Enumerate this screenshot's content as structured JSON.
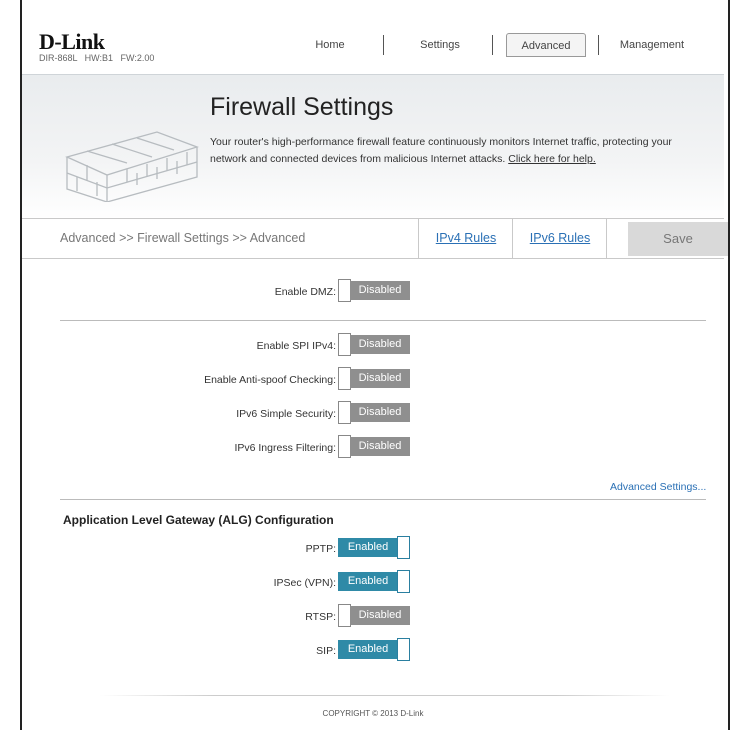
{
  "header": {
    "logo": "D-Link",
    "model_info": "DIR-868L   HW:B1   FW:2.00",
    "nav": [
      {
        "label": "Home"
      },
      {
        "label": "Settings"
      },
      {
        "label": "Advanced",
        "active": true
      },
      {
        "label": "Management"
      }
    ]
  },
  "hero": {
    "title": "Firewall Settings",
    "description": "Your router's high-performance firewall feature continuously monitors Internet traffic, protecting your network and connected devices from malicious Internet attacks. ",
    "help_link": "Click here for help."
  },
  "breadcrumb": {
    "path": "Advanced >> Firewall Settings >> Advanced",
    "ipv4_rules": "IPv4 Rules",
    "ipv6_rules": "IPv6 Rules",
    "save": "Save"
  },
  "dmz": {
    "label": "Enable DMZ:",
    "state": "Disabled"
  },
  "security": {
    "spi": {
      "label": "Enable SPI IPv4:",
      "state": "Disabled"
    },
    "antispoof": {
      "label": "Enable Anti-spoof Checking:",
      "state": "Disabled"
    },
    "ipv6_simple": {
      "label": "IPv6 Simple Security:",
      "state": "Disabled"
    },
    "ipv6_ingress": {
      "label": "IPv6 Ingress Filtering:",
      "state": "Disabled"
    }
  },
  "advanced_settings_link": "Advanced Settings...",
  "alg": {
    "title": "Application Level Gateway (ALG) Configuration",
    "pptp": {
      "label": "PPTP:",
      "state": "Enabled"
    },
    "ipsec": {
      "label": "IPSec (VPN):",
      "state": "Enabled"
    },
    "rtsp": {
      "label": "RTSP:",
      "state": "Disabled"
    },
    "sip": {
      "label": "SIP:",
      "state": "Enabled"
    }
  },
  "footer": {
    "copyright": "COPYRIGHT © 2013 D-Link"
  },
  "colors": {
    "enabled": "#2f8aa7",
    "disabled": "#8f8f8f",
    "link": "#2a70b5"
  }
}
